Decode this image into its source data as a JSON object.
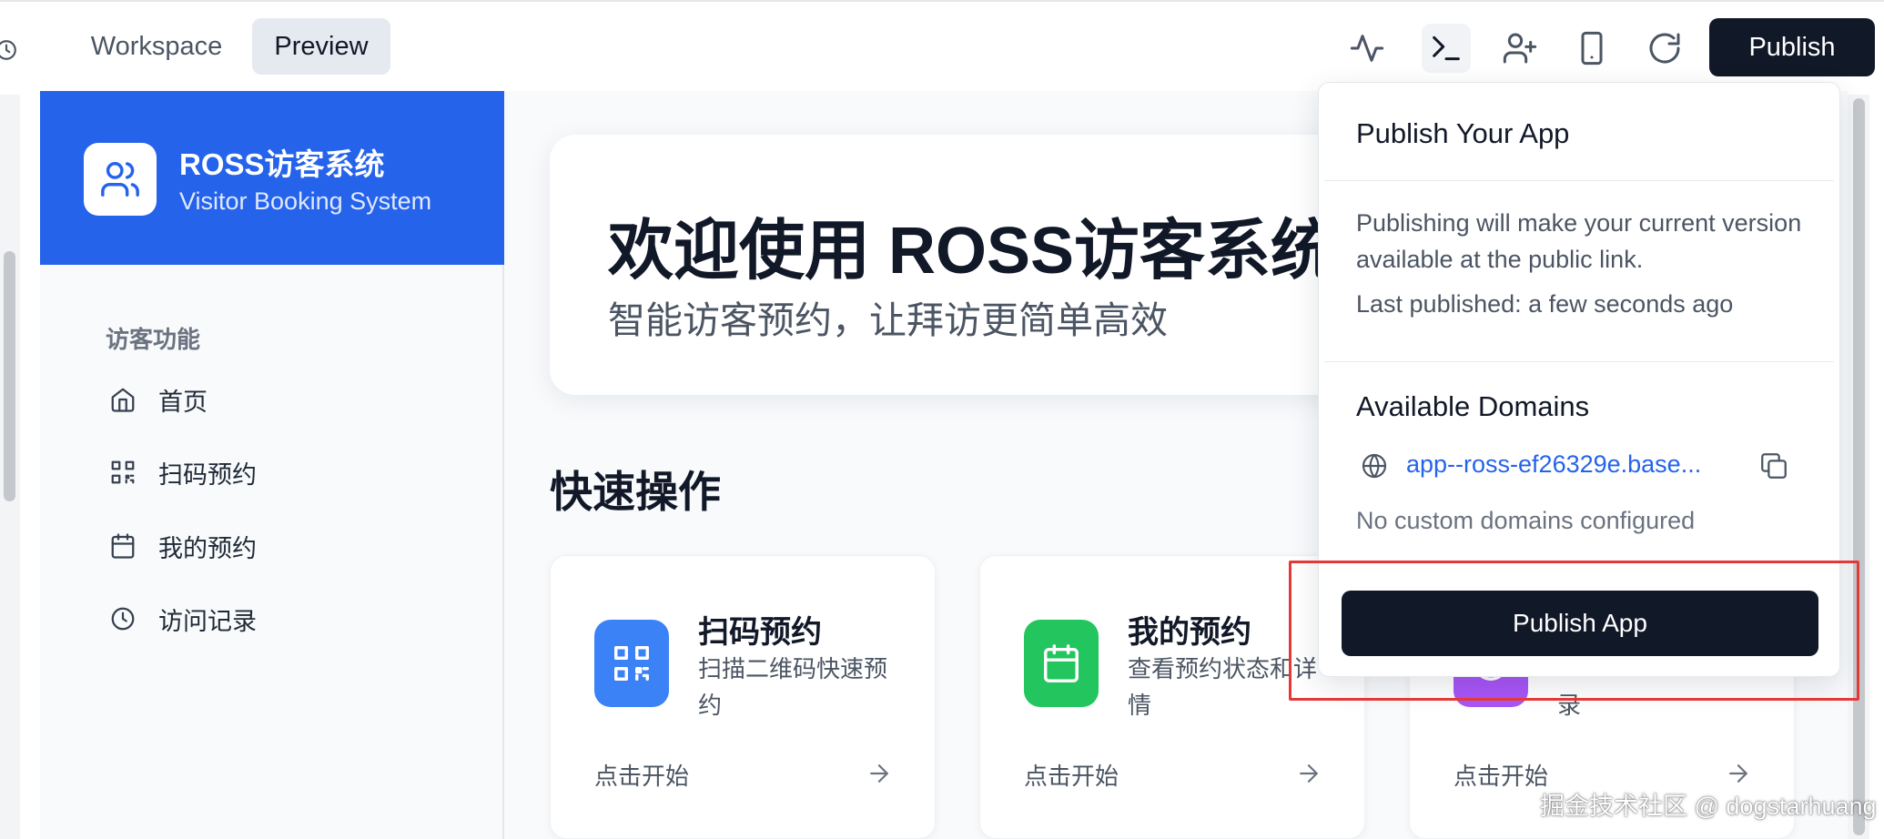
{
  "topbar": {
    "tabs": [
      {
        "label": "Workspace"
      },
      {
        "label": "Preview"
      }
    ],
    "publish_label": "Publish",
    "icons": [
      "history-icon",
      "activity-icon",
      "terminal-icon",
      "add-user-icon",
      "mobile-icon",
      "refresh-icon"
    ]
  },
  "sidebar": {
    "brand_title": "ROSS访客系统",
    "brand_subtitle": "Visitor Booking System",
    "section_label": "访客功能",
    "items": [
      {
        "label": "首页",
        "icon": "home-icon"
      },
      {
        "label": "扫码预约",
        "icon": "qr-code-icon"
      },
      {
        "label": "我的预约",
        "icon": "calendar-icon"
      },
      {
        "label": "访问记录",
        "icon": "clock-icon"
      }
    ]
  },
  "main": {
    "hero_title": "欢迎使用 ROSS访客系统",
    "hero_subtitle": "智能访客预约，让拜访更简单高效",
    "quick_title": "快速操作",
    "cards": [
      {
        "title": "扫码预约",
        "desc": "扫描二维码快速预约",
        "action": "点击开始",
        "color": "#3b82f6",
        "icon": "qr-code-icon"
      },
      {
        "title": "我的预约",
        "desc": "查看预约状态和详情",
        "action": "点击开始",
        "color": "#22c55e",
        "icon": "calendar-icon"
      },
      {
        "title": "",
        "desc": "录",
        "action": "点击开始",
        "color": "#a855f7",
        "icon": "clock-icon"
      }
    ]
  },
  "popover": {
    "title": "Publish Your App",
    "description": "Publishing will make your current version available at the public link.",
    "last_published": "Last published: a few seconds ago",
    "domains_title": "Available Domains",
    "domain": "app--ross-ef26329e.base...",
    "no_custom": "No custom domains configured",
    "publish_app_label": "Publish App"
  },
  "colors": {
    "brand_blue": "#2563eb",
    "dark_button": "#111827",
    "highlight_red": "#e53935"
  },
  "watermark": "掘金技术社区 @ dogstarhuang"
}
